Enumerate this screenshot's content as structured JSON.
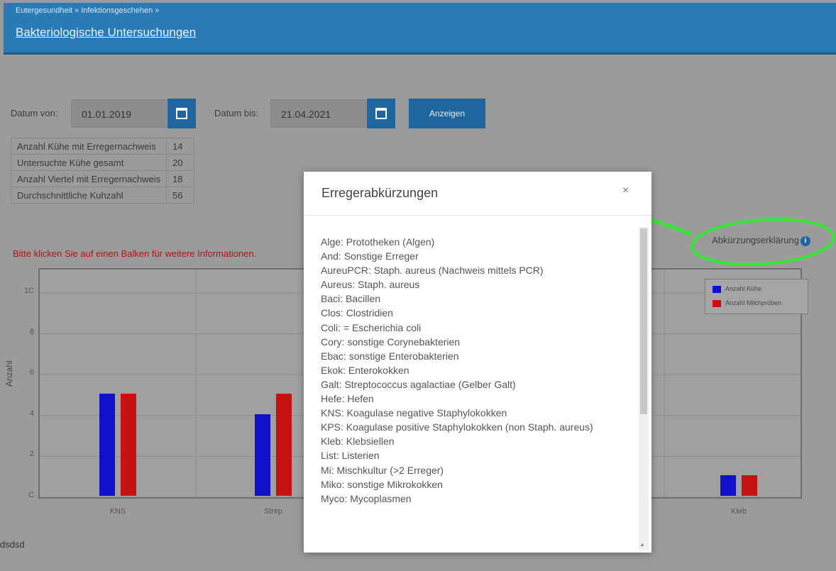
{
  "header": {
    "breadcrumb": "Eutergesundheit » Infektionsgeschehen »",
    "title": "Bakteriologische Untersuchungen"
  },
  "filters": {
    "from_label": "Datum von:",
    "from_value": "01.01.2019",
    "to_label": "Datum bis:",
    "to_value": "21.04.2021",
    "show_button": "Anzeigen"
  },
  "stats": [
    {
      "label": "Anzahl Kühe mit Erregernachweis",
      "value": "14"
    },
    {
      "label": "Untersuchte Kühe gesamt",
      "value": "20"
    },
    {
      "label": "Anzahl Viertel mit Erregernachweis",
      "value": "18"
    },
    {
      "label": "Durchschnittliche Kuhzahl",
      "value": "56"
    }
  ],
  "hint": "Bitte klicken Sie auf einen Balken für weitere Informationen.",
  "abbr_link": "Abkürzungserklärung",
  "footer_text": "dsdsd",
  "chart_data": {
    "type": "bar",
    "categories": [
      "KNS",
      "Strep",
      "Kleb"
    ],
    "series": [
      {
        "name": "Anzahl Kühe",
        "color": "#1010c8",
        "values": [
          5,
          4,
          1
        ]
      },
      {
        "name": "Anzahl Milchproben",
        "color": "#c81212",
        "values": [
          5,
          5,
          1
        ]
      }
    ],
    "ylabel": "Anzahl",
    "yticks": [
      "C",
      "2",
      "4",
      "6",
      "8",
      "1C"
    ],
    "ylim": [
      0,
      10
    ],
    "grid": true,
    "legend": "top-right"
  },
  "modal": {
    "title": "Erregerabkürzungen",
    "close": "×",
    "items": [
      "Alge: Prototheken (Algen)",
      "And: Sonstige Erreger",
      "AureuPCR: Staph. aureus (Nachweis mittels PCR)",
      "Aureus: Staph. aureus",
      "Baci: Bacillen",
      "Clos: Clostridien",
      "Coli: = Escherichia coli",
      "Cory: sonstige Corynebakterien",
      "Ebac: sonstige Enterobakterien",
      "Ekok: Enterokokken",
      "Galt: Streptococcus agalactiae (Gelber Galt)",
      "Hefe: Hefen",
      "KNS: Koagulase negative Staphylokokken",
      "KPS: Koagulase positive Staphylokokken (non Staph. aureus)",
      "Kleb: Klebsiellen",
      "List: Listerien",
      "Mi: Mischkultur (>2 Erreger)",
      "Miko: sonstige Mikrokokken",
      "Myco: Mycoplasmen"
    ]
  },
  "colors": {
    "header": "#2a7ab5",
    "button": "#1f65a0",
    "hint": "#b21414",
    "annotation": "#33e633"
  }
}
